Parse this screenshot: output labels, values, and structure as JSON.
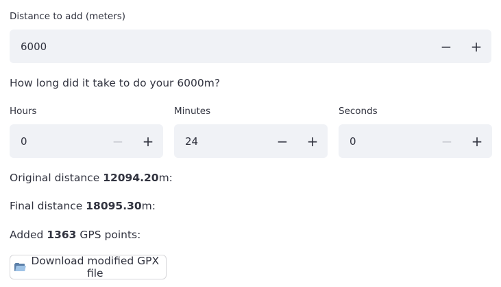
{
  "distance": {
    "label": "Distance to add (meters)",
    "value": "6000"
  },
  "question": "How long did it take to do your 6000m?",
  "time": {
    "hours": {
      "label": "Hours",
      "value": "0",
      "minus_disabled": true
    },
    "minutes": {
      "label": "Minutes",
      "value": "24",
      "minus_disabled": false
    },
    "seconds": {
      "label": "Seconds",
      "value": "0",
      "minus_disabled": true
    }
  },
  "stepper": {
    "minus": "−",
    "plus": "+"
  },
  "results": {
    "original_prefix": "Original distance ",
    "original_value": "12094.20",
    "original_suffix": "m:",
    "final_prefix": "Final distance ",
    "final_value": "18095.30",
    "final_suffix": "m:",
    "added_prefix": "Added ",
    "added_value": "1363",
    "added_suffix": " GPS points:"
  },
  "download_button": {
    "icon": "folder-icon",
    "label": "Download modified GPX file"
  },
  "colors": {
    "input_bg": "#f0f2f6",
    "text": "#31333f",
    "disabled": "#c7c9d0"
  }
}
